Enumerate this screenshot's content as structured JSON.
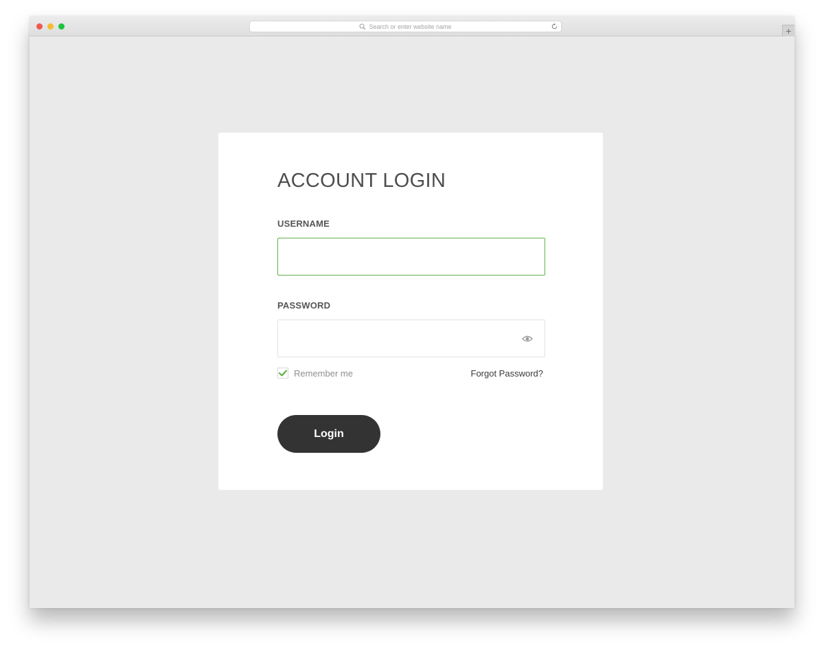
{
  "browser": {
    "address_placeholder": "Search or enter website name",
    "new_tab_glyph": "+",
    "traffic_lights": {
      "close": "#ee5a52",
      "minimize": "#f5bd30",
      "maximize": "#1fc33d"
    }
  },
  "login": {
    "title": "ACCOUNT LOGIN",
    "username_label": "USERNAME",
    "username_value": "",
    "password_label": "PASSWORD",
    "password_value": "",
    "password_toggle_icon": "eye-icon",
    "remember_label": "Remember me",
    "remember_checked": true,
    "forgot_label": "Forgot Password?",
    "submit_label": "Login"
  },
  "colors": {
    "accent_green": "#61b04a",
    "button_dark": "#333333",
    "page_background": "#eaeaeb",
    "card_background": "#ffffff"
  }
}
